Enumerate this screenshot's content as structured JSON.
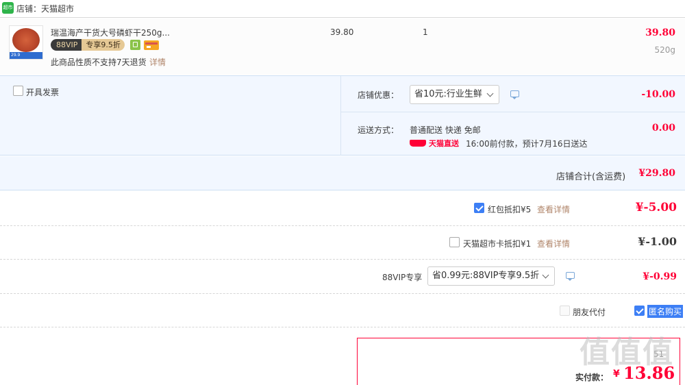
{
  "shop": {
    "label": "店铺：天猫超市",
    "logo_text": "超市"
  },
  "item": {
    "title": "瑞温海产干货大号磷虾干250g...",
    "vip_badge": "88VIP",
    "vip_discount": "专享9.5折",
    "thumb_price": "29.9",
    "unit_price": "39.80",
    "quantity": "1",
    "total": "39.80",
    "weight": "520g",
    "return_note": "此商品性质不支持7天退货",
    "detail_link": "详情"
  },
  "invoice": {
    "label": "开具发票",
    "checked": false
  },
  "shop_discount": {
    "label": "店铺优惠：",
    "selected": "省10元:行业生鲜",
    "amount": "-10.00"
  },
  "shipping": {
    "label": "运送方式：",
    "method": "普通配送 快递 免邮",
    "brand": "天猫直送",
    "eta": "16:00前付款，预计7月16日送达",
    "amount": "0.00"
  },
  "shop_total": {
    "label": "店铺合计(含运费)",
    "amount": "¥29.80"
  },
  "red_packet": {
    "label": "红包抵扣¥5",
    "detail": "查看详情",
    "amount": "¥-5.00",
    "checked": true
  },
  "market_card": {
    "label": "天猫超市卡抵扣¥1",
    "detail": "查看详情",
    "amount": "¥-1.00",
    "checked": false
  },
  "vip": {
    "label": "88VIP专享",
    "selected": "省0.99元:88VIP专享9.5折",
    "amount": "¥-0.99"
  },
  "options": {
    "friend_pay": "朋友代付",
    "anonymous": "匿名购买"
  },
  "payment": {
    "label": "实付款：",
    "currency": "¥",
    "amount": "13.86",
    "saved_partial": "51"
  },
  "watermark": "值",
  "colors": {
    "accent_red": "#ff0036",
    "panel_bg": "#f2f7ff",
    "check_blue": "#3d7ff5",
    "brand_green": "#4caf50"
  }
}
